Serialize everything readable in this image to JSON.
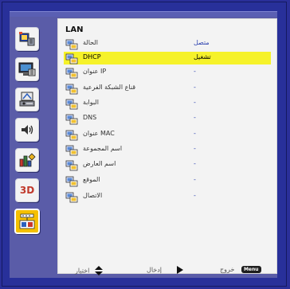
{
  "section_title": "LAN",
  "rows": [
    {
      "label": "الحالة",
      "value": "متصل"
    },
    {
      "label": "DHCP",
      "value": "تشغيل"
    },
    {
      "label": "عنوان IP",
      "value": "-"
    },
    {
      "label": "قناع الشبكة الفرعية",
      "value": "-"
    },
    {
      "label": "البوابة",
      "value": "-"
    },
    {
      "label": "DNS",
      "value": "-"
    },
    {
      "label": "عنوان MAC",
      "value": "-"
    },
    {
      "label": "اسم المجموعة",
      "value": "-"
    },
    {
      "label": "اسم العارض",
      "value": "-"
    },
    {
      "label": "الموقع",
      "value": "-"
    },
    {
      "label": "الاتصال",
      "value": "-"
    }
  ],
  "selected_row": 1,
  "sidebar": [
    {
      "icon": "image-settings-icon"
    },
    {
      "icon": "display-icon"
    },
    {
      "icon": "settings-icon"
    },
    {
      "icon": "volume-icon"
    },
    {
      "icon": "options-icon"
    },
    {
      "icon": "3d-icon",
      "text": "3D"
    },
    {
      "icon": "network-icon",
      "active": true
    }
  ],
  "footer": {
    "select_label": "اختيار",
    "enter_label": "إدخال",
    "exit_label": "خروج",
    "menu_label": "Menu"
  },
  "colors": {
    "background": "#2a2f99",
    "panel": "#5a5ca8",
    "content": "#f3f3f3",
    "highlight": "#f6f22a",
    "active_icon": "#f5c000",
    "value_text": "#2a3fae"
  }
}
